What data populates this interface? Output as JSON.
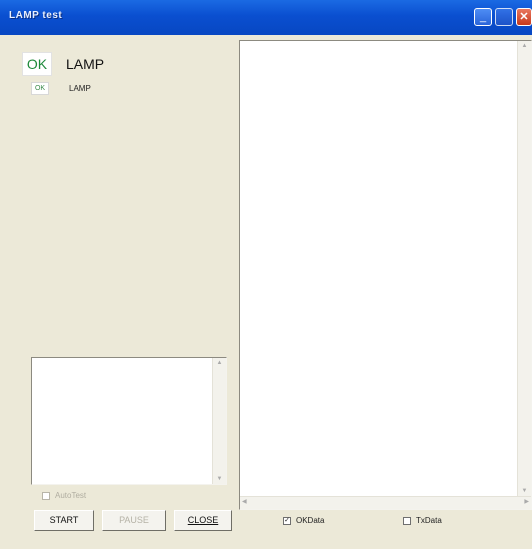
{
  "window": {
    "title": "LAMP test"
  },
  "titlebar_icons": [
    "minimize-icon",
    "maximize-icon",
    "close-icon"
  ],
  "titlebar_glyphs": {
    "minimize": "_",
    "close": "✕"
  },
  "lamp_large": {
    "status": "OK",
    "label": "LAMP"
  },
  "lamp_small": {
    "status": "OK",
    "label": "LAMP"
  },
  "controls": {
    "autotest_label": "AutoTest",
    "autotest_checked": false,
    "start_label": "START",
    "pause_label": "PAUSE",
    "close_label": "CLOSE"
  },
  "filters": {
    "okdata_label": "OKData",
    "okdata_checked": true,
    "txdata_label": "TxData",
    "txdata_checked": false
  },
  "colors": {
    "ok_text": "#1e8a3a",
    "titlebar": "#0a4fd0"
  }
}
